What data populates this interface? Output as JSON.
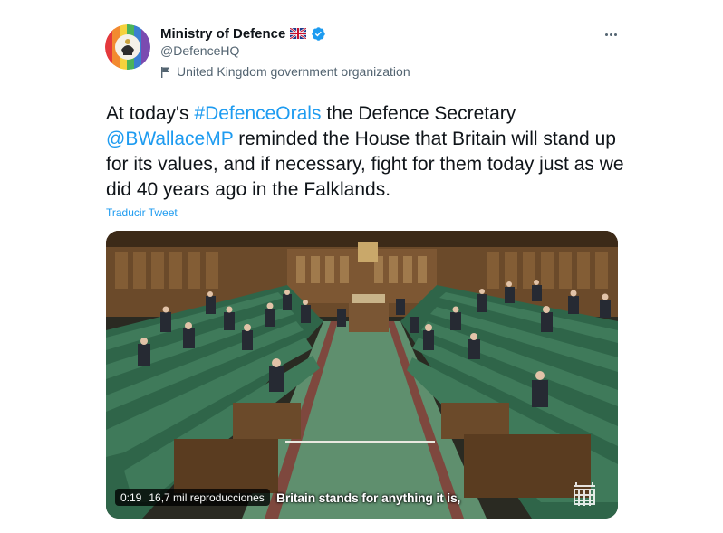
{
  "tweet": {
    "author": {
      "display_name": "Ministry of Defence",
      "flag_emoji": "uk-flag",
      "verified": true,
      "handle": "@DefenceHQ",
      "label": "United Kingdom government organization"
    },
    "text": {
      "part1": "At today's ",
      "hashtag": "#DefenceOrals",
      "part2": " the Defence Secretary ",
      "mention": "@BWallaceMP",
      "part3": " reminded the House that Britain will stand up for its values, and if necessary, fight for them today just as we did 40 years ago in the Falklands."
    },
    "translate_label": "Traducir Tweet",
    "media": {
      "duration": "0:19",
      "views": "16,7 mil reproducciones",
      "caption": "Britain stands for anything it is,"
    }
  },
  "icons": {
    "more": "more-options-icon",
    "verified": "verified-badge-icon",
    "gov_label": "flag-icon",
    "watermark": "portcullis-icon"
  },
  "colors": {
    "link": "#1d9bf0",
    "secondary_text": "#536471",
    "primary_text": "#0f1419",
    "bench_green": "#3f7a5a"
  }
}
